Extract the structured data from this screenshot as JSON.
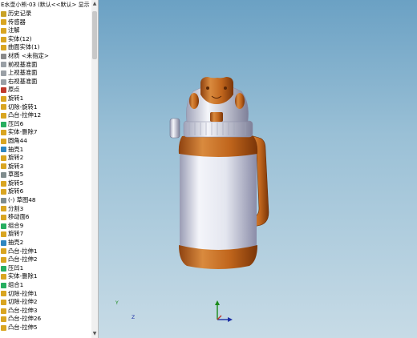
{
  "panel": {
    "title": "E水壶小熊-03 (默认<<默认> 显示"
  },
  "tree_items": [
    {
      "label": "历史记录",
      "icon": "history-icon",
      "color": "#c9a227"
    },
    {
      "label": "传感器",
      "icon": "sensor-icon",
      "color": "#d9a521"
    },
    {
      "label": "注解",
      "icon": "annotation-icon",
      "color": "#d9a521"
    },
    {
      "label": "实体(12)",
      "icon": "solid-bodies-icon",
      "color": "#d9a521"
    },
    {
      "label": "曲面实体(1)",
      "icon": "surface-bodies-icon",
      "color": "#d9a521"
    },
    {
      "label": "材质 <未指定>",
      "icon": "material-icon",
      "color": "#8a8a8a"
    },
    {
      "label": "前视基准面",
      "icon": "plane-icon",
      "color": "#9aa0a6"
    },
    {
      "label": "上视基准面",
      "icon": "plane-icon",
      "color": "#9aa0a6"
    },
    {
      "label": "右视基准面",
      "icon": "plane-icon",
      "color": "#9aa0a6"
    },
    {
      "label": "原点",
      "icon": "origin-icon",
      "color": "#c0392b"
    },
    {
      "label": "旋转1",
      "icon": "revolve-icon",
      "color": "#d9a521"
    },
    {
      "label": "切除-旋转1",
      "icon": "cut-revolve-icon",
      "color": "#d9a521"
    },
    {
      "label": "凸台-拉伸12",
      "icon": "boss-extrude-icon",
      "color": "#d9a521"
    },
    {
      "label": "压凹6",
      "icon": "indent-icon",
      "color": "#27ae60"
    },
    {
      "label": "实体-删除7",
      "icon": "delete-body-icon",
      "color": "#d9a521"
    },
    {
      "label": "圆角44",
      "icon": "fillet-icon",
      "color": "#d9a521"
    },
    {
      "label": "抽壳1",
      "icon": "shell-icon",
      "color": "#2e86c1"
    },
    {
      "label": "旋转2",
      "icon": "revolve-icon",
      "color": "#d9a521"
    },
    {
      "label": "旋转3",
      "icon": "revolve-icon",
      "color": "#d9a521"
    },
    {
      "label": "草图5",
      "icon": "sketch-icon",
      "color": "#7f8c8d"
    },
    {
      "label": "旋转5",
      "icon": "revolve-icon",
      "color": "#d9a521"
    },
    {
      "label": "旋转6",
      "icon": "revolve-icon",
      "color": "#d9a521"
    },
    {
      "label": "(-) 草图48",
      "icon": "sketch-icon",
      "color": "#7f8c8d"
    },
    {
      "label": "分割3",
      "icon": "split-icon",
      "color": "#d9a521"
    },
    {
      "label": "移动面6",
      "icon": "move-face-icon",
      "color": "#d9a521"
    },
    {
      "label": "组合9",
      "icon": "combine-icon",
      "color": "#27ae60"
    },
    {
      "label": "旋转7",
      "icon": "revolve-icon",
      "color": "#d9a521"
    },
    {
      "label": "抽壳2",
      "icon": "shell-icon",
      "color": "#2e86c1"
    },
    {
      "label": "凸台-拉伸1",
      "icon": "boss-extrude-icon",
      "color": "#d9a521"
    },
    {
      "label": "凸台-拉伸2",
      "icon": "boss-extrude-icon",
      "color": "#d9a521"
    },
    {
      "label": "压凹1",
      "icon": "indent-icon",
      "color": "#27ae60"
    },
    {
      "label": "实体-删除1",
      "icon": "delete-body-icon",
      "color": "#d9a521"
    },
    {
      "label": "组合1",
      "icon": "combine-icon",
      "color": "#27ae60"
    },
    {
      "label": "切除-拉伸1",
      "icon": "cut-extrude-icon",
      "color": "#d9a521"
    },
    {
      "label": "切除-拉伸2",
      "icon": "cut-extrude-icon",
      "color": "#d9a521"
    },
    {
      "label": "凸台-拉伸3",
      "icon": "boss-extrude-icon",
      "color": "#d9a521"
    },
    {
      "label": "凸台-拉伸26",
      "icon": "boss-extrude-icon",
      "color": "#d9a521"
    },
    {
      "label": "凸台-拉伸5",
      "icon": "boss-extrude-icon",
      "color": "#d9a521"
    }
  ],
  "triad": {
    "y_label": "Y",
    "z_label": "Z"
  },
  "colors": {
    "model_orange": "#c0651c",
    "model_white": "#dde0ea",
    "viewport_top": "#6ba1c4",
    "viewport_bottom": "#c7dbe6"
  }
}
